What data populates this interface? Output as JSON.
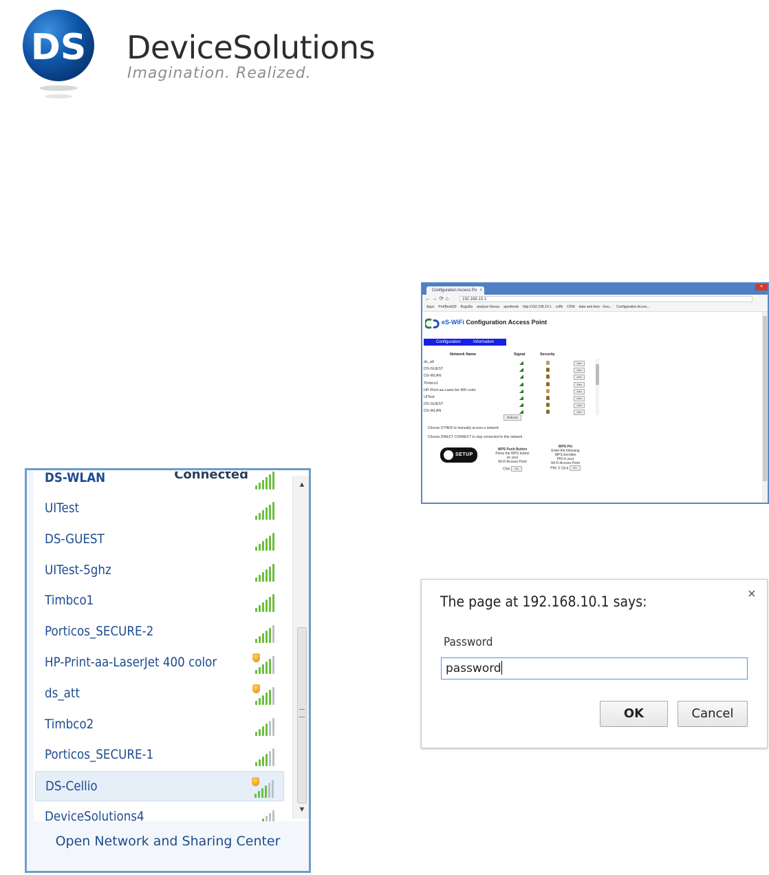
{
  "logo": {
    "initials": "DS",
    "company": "DeviceSolutions",
    "tagline": "Imagination. Realized."
  },
  "wifi_panel": {
    "partial_top": {
      "name": "DS-WLAN",
      "status": "Connected"
    },
    "networks": [
      {
        "name": "UITest",
        "secured": false,
        "strength": 5
      },
      {
        "name": "DS-GUEST",
        "secured": false,
        "strength": 5
      },
      {
        "name": "UITest-5ghz",
        "secured": false,
        "strength": 5
      },
      {
        "name": "Timbco1",
        "secured": false,
        "strength": 5
      },
      {
        "name": "Porticos_SECURE-2",
        "secured": false,
        "strength": 4
      },
      {
        "name": "HP-Print-aa-LaserJet 400 color",
        "secured": true,
        "strength": 4
      },
      {
        "name": "ds_att",
        "secured": true,
        "strength": 4
      },
      {
        "name": "Timbco2",
        "secured": false,
        "strength": 3
      },
      {
        "name": "Porticos_SECURE-1",
        "secured": false,
        "strength": 3
      },
      {
        "name": "DS-Cellio",
        "secured": true,
        "strength": 3,
        "selected": true
      },
      {
        "name": "DeviceSolutions4",
        "secured": false,
        "strength": 2
      }
    ],
    "footer_link": "Open Network and Sharing Center",
    "signal_color": "#6abf3d"
  },
  "browser": {
    "tab_title": "Configuration Access Po",
    "url": "192.168.10.1",
    "bookmarks": [
      "Apps",
      "ProfBook00",
      "Bugzilla",
      "analyze-Nexus",
      "aprsfeeds",
      "http://192.168.10.1",
      "cnffs",
      "CRM",
      "date and time - Goo...",
      "Configuration Acces..."
    ],
    "page": {
      "brand": "eS-WiFi",
      "title_rest": "Configuration Access Point",
      "nav": [
        "Configuration",
        "Information"
      ],
      "columns": [
        "Network Name",
        "Signal",
        "Security"
      ],
      "rows": [
        {
          "name": "ds_att",
          "open": true
        },
        {
          "name": "DS-GUEST",
          "open": false
        },
        {
          "name": "DS-WLAN",
          "open": false
        },
        {
          "name": "Timbco1",
          "open": false
        },
        {
          "name": "HP-Print-aa-LaserJet 400 color",
          "open": true
        },
        {
          "name": "UITest",
          "open": false
        },
        {
          "name": "DS-GUEST",
          "open": false
        },
        {
          "name": "DS-WLAN",
          "open": false
        }
      ],
      "join_label": "Join",
      "refresh_label": "Refresh",
      "note_other": "Choose OTHER to manually access a network",
      "note_direct": "Choose DIRECT CONNECT to stay connected to this network",
      "wps_badge": "SETUP",
      "wps_push": {
        "heading": "WPS Push Button",
        "lines": [
          "Press the WPS button",
          "on your",
          "Wi-Fi Access Point"
        ],
        "click": "Click",
        "go": "Go"
      },
      "wps_pin": {
        "heading": "WPS Pin",
        "lines": [
          "Enter the following",
          "WPS Enrollee",
          "PIN in your",
          "Wi-Fi Access Point"
        ],
        "pin": "PIN: 0",
        "click": "Click",
        "go": "Go"
      }
    }
  },
  "dialog": {
    "title": "The page at 192.168.10.1 says:",
    "label": "Password",
    "value": "password",
    "ok": "OK",
    "cancel": "Cancel",
    "close": "×"
  }
}
